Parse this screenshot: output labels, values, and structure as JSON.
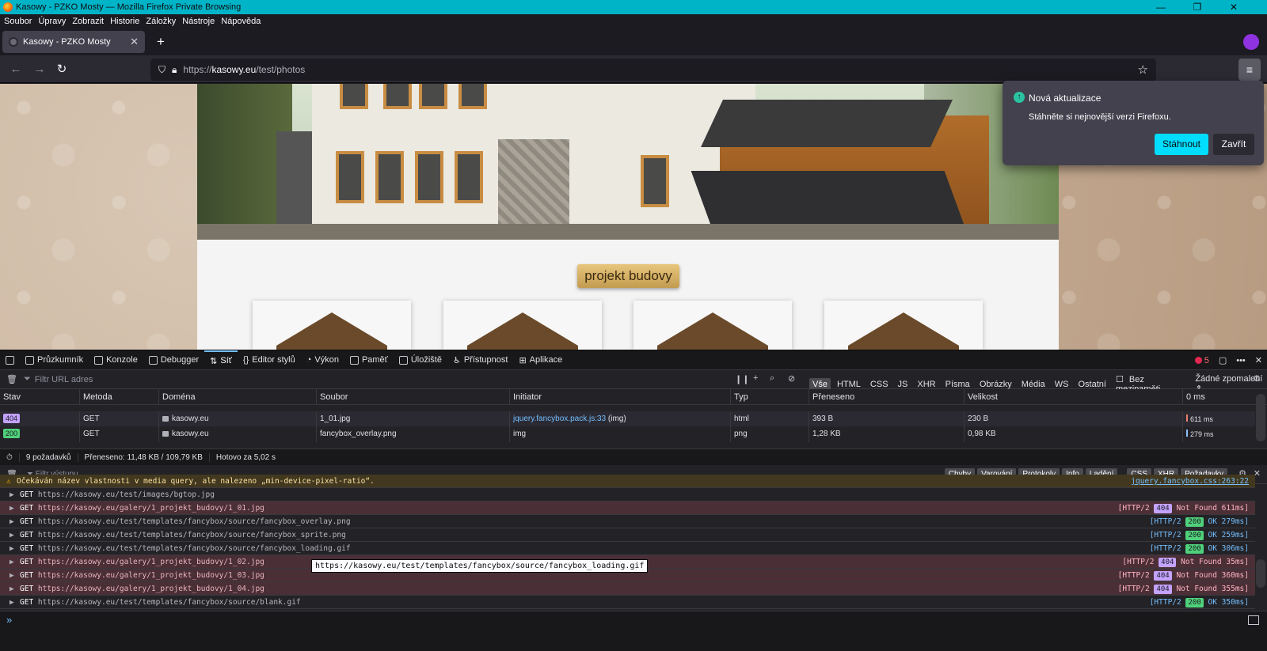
{
  "window": {
    "title": "Kasowy - PZKO Mosty — Mozilla Firefox Private Browsing"
  },
  "menu": [
    "Soubor",
    "Úpravy",
    "Zobrazit",
    "Historie",
    "Záložky",
    "Nástroje",
    "Nápověda"
  ],
  "tab": {
    "title": "Kasowy - PZKO Mosty"
  },
  "url": {
    "prefix": "https://",
    "domain": "kasowy.eu",
    "path": "/test/photos"
  },
  "page": {
    "section_label": "projekt budovy"
  },
  "notification": {
    "title": "Nová aktualizace",
    "message": "Stáhněte si nejnovější verzi Firefoxu.",
    "primary": "Stáhnout",
    "secondary": "Zavřít"
  },
  "devtools": {
    "tabs": [
      "Průzkumník",
      "Konzole",
      "Debugger",
      "Síť",
      "Editor stylů",
      "Výkon",
      "Paměť",
      "Úložiště",
      "Přístupnost",
      "Aplikace"
    ],
    "active_tab": "Síť",
    "error_count": "5",
    "net": {
      "filter_placeholder": "Filtr URL adres",
      "types": [
        "Vše",
        "HTML",
        "CSS",
        "JS",
        "XHR",
        "Písma",
        "Obrázky",
        "Média",
        "WS",
        "Ostatní"
      ],
      "no_cache_label": "Bez mezipaměti",
      "throttle_label": "Žádné zpomalení ⇕",
      "columns": [
        "Stav",
        "Metoda",
        "Doména",
        "Soubor",
        "Initiator",
        "Typ",
        "Přeneseno",
        "Velikost",
        "0 ms"
      ],
      "rows": [
        {
          "status": "404",
          "method": "GET",
          "domain": "kasowy.eu",
          "file": "1_01.jpg",
          "initiator_link": "jquery.fancybox.pack.js:33",
          "initiator_rest": " (img)",
          "type": "html",
          "transferred": "393 B",
          "size": "230 B",
          "timing": "611 ms"
        },
        {
          "status": "200",
          "method": "GET",
          "domain": "kasowy.eu",
          "file": "fancybox_overlay.png",
          "initiator_link": "",
          "initiator_rest": "img",
          "type": "png",
          "transferred": "1,28 KB",
          "size": "0,98 KB",
          "timing": "279 ms"
        }
      ],
      "status": {
        "requests": "9 požadavků",
        "transferred": "Přeneseno: 11,48 KB / 109,79 KB",
        "finished": "Hotovo za 5,02 s"
      }
    },
    "console": {
      "filter_placeholder": "Filtr výstupu",
      "level_buttons": [
        "Chyby",
        "Varování",
        "Protokoly",
        "Info",
        "Ladění"
      ],
      "type_buttons": [
        "CSS",
        "XHR",
        "Požadavky"
      ],
      "warning": {
        "text": "Očekáván název vlastnosti v media query, ale nalezeno „min-device-pixel-ratio“.",
        "location": "jquery.fancybox.css:263:22"
      },
      "entries": [
        {
          "method": "GET",
          "url": "https://kasowy.eu/test/images/bgtop.jpg",
          "kind": "ok",
          "http": "",
          "code": "",
          "status_text": "",
          "time": ""
        },
        {
          "method": "GET",
          "url": "https://kasowy.eu/galery/1_projekt_budovy/1_01.jpg",
          "kind": "err",
          "http": "[HTTP/2",
          "code": "404",
          "status_text": "Not Found",
          "time": "611ms]"
        },
        {
          "method": "GET",
          "url": "https://kasowy.eu/test/templates/fancybox/source/fancybox_overlay.png",
          "kind": "ok",
          "http": "[HTTP/2",
          "code": "200",
          "status_text": "OK",
          "time": "279ms]"
        },
        {
          "method": "GET",
          "url": "https://kasowy.eu/test/templates/fancybox/source/fancybox_sprite.png",
          "kind": "ok",
          "http": "[HTTP/2",
          "code": "200",
          "status_text": "OK",
          "time": "259ms]"
        },
        {
          "method": "GET",
          "url": "https://kasowy.eu/test/templates/fancybox/source/fancybox_loading.gif",
          "kind": "ok",
          "http": "[HTTP/2",
          "code": "200",
          "status_text": "OK",
          "time": "306ms]"
        },
        {
          "method": "GET",
          "url": "https://kasowy.eu/galery/1_projekt_budovy/1_02.jpg",
          "kind": "err",
          "http": "[HTTP/2",
          "code": "404",
          "status_text": "Not Found",
          "time": "35ms]"
        },
        {
          "method": "GET",
          "url": "https://kasowy.eu/galery/1_projekt_budovy/1_03.jpg",
          "kind": "err",
          "http": "[HTTP/2",
          "code": "404",
          "status_text": "Not Found",
          "time": "360ms]"
        },
        {
          "method": "GET",
          "url": "https://kasowy.eu/galery/1_projekt_budovy/1_04.jpg",
          "kind": "err",
          "http": "[HTTP/2",
          "code": "404",
          "status_text": "Not Found",
          "time": "355ms]"
        },
        {
          "method": "GET",
          "url": "https://kasowy.eu/test/templates/fancybox/source/blank.gif",
          "kind": "ok",
          "http": "[HTTP/2",
          "code": "200",
          "status_text": "OK",
          "time": "350ms]"
        }
      ],
      "tooltip": "https://kasowy.eu/test/templates/fancybox/source/fancybox_loading.gif"
    }
  }
}
